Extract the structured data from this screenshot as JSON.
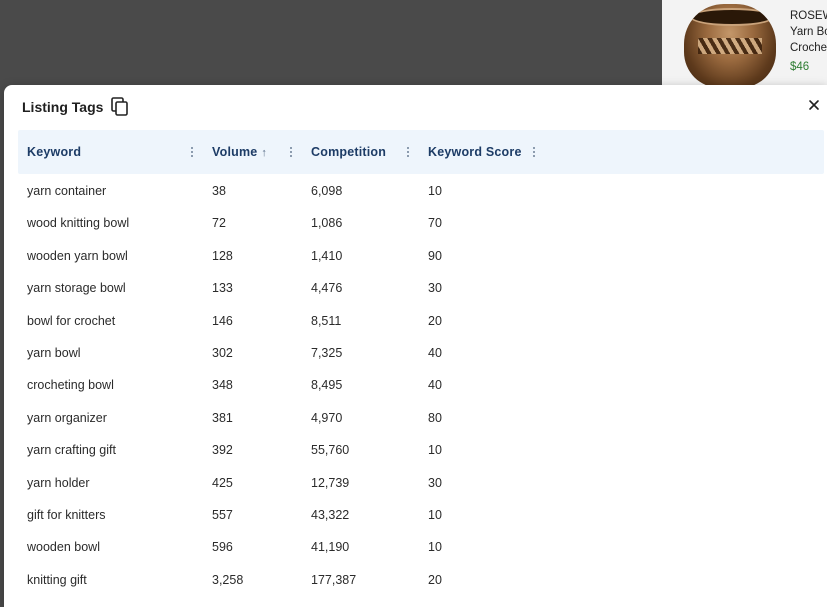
{
  "background_card": {
    "title_lines": [
      "ROSEW",
      "Yarn Bo",
      "Crochet"
    ],
    "price": "$46"
  },
  "modal": {
    "title": "Listing Tags",
    "columns": [
      {
        "label": "Keyword",
        "sort": ""
      },
      {
        "label": "Volume",
        "sort": "↑"
      },
      {
        "label": "Competition",
        "sort": ""
      },
      {
        "label": "Keyword Score",
        "sort": ""
      }
    ],
    "rows": [
      {
        "keyword": "yarn container",
        "volume": "38",
        "competition": "6,098",
        "score": "10"
      },
      {
        "keyword": "wood knitting bowl",
        "volume": "72",
        "competition": "1,086",
        "score": "70"
      },
      {
        "keyword": "wooden yarn bowl",
        "volume": "128",
        "competition": "1,410",
        "score": "90"
      },
      {
        "keyword": "yarn storage bowl",
        "volume": "133",
        "competition": "4,476",
        "score": "30"
      },
      {
        "keyword": "bowl for crochet",
        "volume": "146",
        "competition": "8,511",
        "score": "20"
      },
      {
        "keyword": "yarn bowl",
        "volume": "302",
        "competition": "7,325",
        "score": "40"
      },
      {
        "keyword": "crocheting bowl",
        "volume": "348",
        "competition": "8,495",
        "score": "40"
      },
      {
        "keyword": "yarn organizer",
        "volume": "381",
        "competition": "4,970",
        "score": "80"
      },
      {
        "keyword": "yarn crafting gift",
        "volume": "392",
        "competition": "55,760",
        "score": "10"
      },
      {
        "keyword": "yarn holder",
        "volume": "425",
        "competition": "12,739",
        "score": "30"
      },
      {
        "keyword": "gift for knitters",
        "volume": "557",
        "competition": "43,322",
        "score": "10"
      },
      {
        "keyword": "wooden bowl",
        "volume": "596",
        "competition": "41,190",
        "score": "10"
      },
      {
        "keyword": "knitting gift",
        "volume": "3,258",
        "competition": "177,387",
        "score": "20"
      }
    ]
  },
  "icons": {
    "copy": "copy-icon",
    "close": "close-icon",
    "column_menu": "kebab-icon",
    "sort": "sort-ascending-icon"
  },
  "colors": {
    "header_bg": "#eef5fc",
    "header_text": "#1d3c66",
    "price": "#2e7d32",
    "backdrop": "#4a4a4a"
  }
}
